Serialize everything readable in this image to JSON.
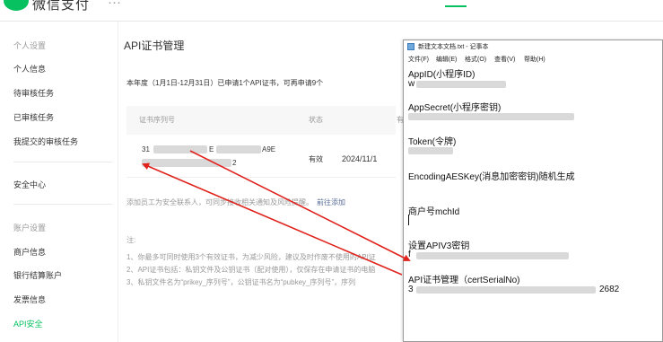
{
  "header": {
    "brand": "微信支付",
    "brand_suffix": "···"
  },
  "sidebar": {
    "group1": "个人设置",
    "items1": [
      "个人信息",
      "待审核任务",
      "已审核任务",
      "我提交的审核任务"
    ],
    "security": "安全中心",
    "group2": "账户设置",
    "items2": [
      "商户信息",
      "银行结算账户",
      "发票信息",
      "API安全"
    ]
  },
  "main": {
    "title": "API证书管理",
    "quota": "本年度（1月1日-12月31日）已申请1个API证书，可再申请9个",
    "table": {
      "headers": [
        "证书序列号",
        "状态",
        "有"
      ],
      "row": {
        "serial_prefix": "31",
        "serial_mid": "E",
        "serial_tail": "A9E",
        "serial_line2_end": "2",
        "status": "有效",
        "date": "2024/11/1"
      }
    },
    "tip": "添加员工为安全联系人，可同步接收相关通知及风险提醒。",
    "tip_link": "前往添加",
    "note_label": "注:",
    "notes": [
      "1、你最多可同时使用3个有效证书，为减少风险，建议及时作废不使用的API证",
      "2、API证书包括：私钥文件及公钥证书（配对使用），仅保存在申请证书的电脑",
      "3、私钥文件名为“prikey_序列号”，公钥证书名为“pubkey_序列号”，序列"
    ]
  },
  "notepad": {
    "title": "新建文本文档.txt - 记事本",
    "menu": [
      "文件(F)",
      "编辑(E)",
      "格式(O)",
      "查看(V)",
      "帮助(H)"
    ],
    "lines": {
      "appid_label": "AppID(小程序ID)",
      "appid_value": "w",
      "appsecret_label": "AppSecret(小程序密钥)",
      "token_label": "Token(令牌)",
      "aeskey_label": "EncodingAESKey(消息加密密钥)随机生成",
      "mchid_label": "商户号mchId",
      "apiv3_label": "设置APIV3密钥",
      "apiv3_value": "f",
      "cert_label": "API证书管理（certSerialNo)",
      "cert_value": "3",
      "cert_value_tail": "2682"
    }
  },
  "colors": {
    "accent": "#07c160",
    "link": "#576b95",
    "arrow": "#e0231c"
  }
}
